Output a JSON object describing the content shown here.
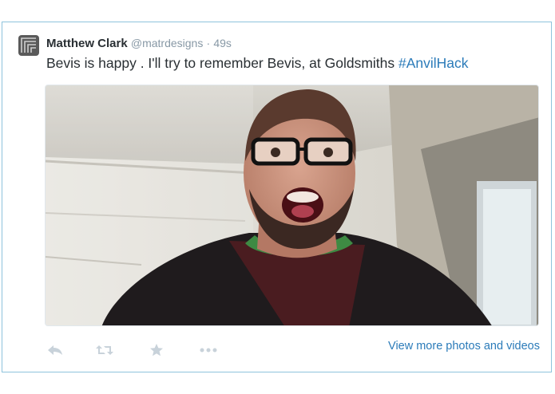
{
  "tweet": {
    "author_name": "Matthew Clark",
    "author_handle": "@matrdesigns",
    "separator": "·",
    "timestamp": "49s",
    "text": "Bevis is happy . I'll try to remember Bevis, at Goldsmiths ",
    "hashtag": "#AnvilHack",
    "photo": "man-with-open-mouth-photo",
    "view_more_label": "View more photos and videos"
  },
  "actions": {
    "icons": [
      "reply-icon",
      "retweet-icon",
      "favorite-icon",
      "more-icon"
    ]
  },
  "colors": {
    "border": "#8ec3dc",
    "link": "#2b7bb9",
    "text": "#292f33",
    "muted": "#8899a6",
    "action_icon": "#c8d2da"
  }
}
